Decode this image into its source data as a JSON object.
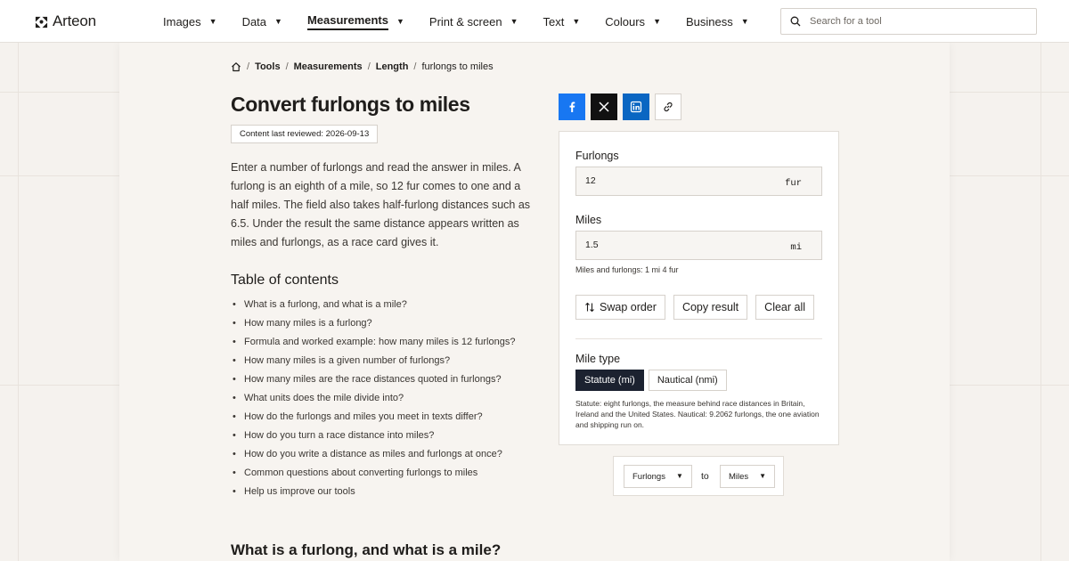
{
  "brand": {
    "name": "Arteon"
  },
  "nav": {
    "items": [
      {
        "label": "Images",
        "active": false
      },
      {
        "label": "Data",
        "active": false
      },
      {
        "label": "Measurements",
        "active": true
      },
      {
        "label": "Print & screen",
        "active": false
      },
      {
        "label": "Text",
        "active": false
      },
      {
        "label": "Colours",
        "active": false
      },
      {
        "label": "Business",
        "active": false
      }
    ],
    "caret": "▼"
  },
  "search": {
    "placeholder": "Search for a tool",
    "value": ""
  },
  "breadcrumb": {
    "items": [
      "Tools",
      "Measurements",
      "Length"
    ],
    "current": "furlongs to miles",
    "separator": "/"
  },
  "page": {
    "title": "Convert furlongs to miles",
    "reviewed": "Content last reviewed: 2026-09-13",
    "intro": "Enter a number of furlongs and read the answer in miles. A furlong is an eighth of a mile, so 12 fur comes to one and a half miles. The field also takes half-furlong distances such as 6.5. Under the result the same distance appears written as miles and furlongs, as a race card gives it.",
    "toc_title": "Table of contents",
    "toc": [
      "What is a furlong, and what is a mile?",
      "How many miles is a furlong?",
      "Formula and worked example: how many miles is 12 furlongs?",
      "How many miles is a given number of furlongs?",
      "How many miles are the race distances quoted in furlongs?",
      "What units does the mile divide into?",
      "How do the furlongs and miles you meet in texts differ?",
      "How do you turn a race distance into miles?",
      "How do you write a distance as miles and furlongs at once?",
      "Common questions about converting furlongs to miles",
      "Help us improve our tools"
    ],
    "section_heading": "What is a furlong, and what is a mile?"
  },
  "share": {
    "icons": [
      "facebook-icon",
      "x-icon",
      "linkedin-icon",
      "link-icon"
    ],
    "colors": {
      "facebook": "#1877f2",
      "x": "#111111",
      "linkedin": "#0a66c2"
    }
  },
  "converter": {
    "from_label": "Furlongs",
    "from_value": "12",
    "from_unit": "fur",
    "to_label": "Miles",
    "to_value": "1.5",
    "to_unit": "mi",
    "mixed": "Miles and furlongs: 1 mi 4 fur",
    "swap_label": "Swap order",
    "copy_label": "Copy result",
    "clear_label": "Clear all",
    "mile_type_label": "Mile type",
    "mile_types": [
      "Statute (mi)",
      "Nautical (nmi)"
    ],
    "selected_mile_type": "Statute (mi)",
    "note": "Statute: eight furlongs, the measure behind race distances in Britain, Ireland and the United States. Nautical: 9.2062 furlongs, the one aviation and shipping run on."
  },
  "unit_switcher": {
    "from": "Furlongs",
    "to_word": "to",
    "to": "Miles",
    "caret": "▼"
  }
}
